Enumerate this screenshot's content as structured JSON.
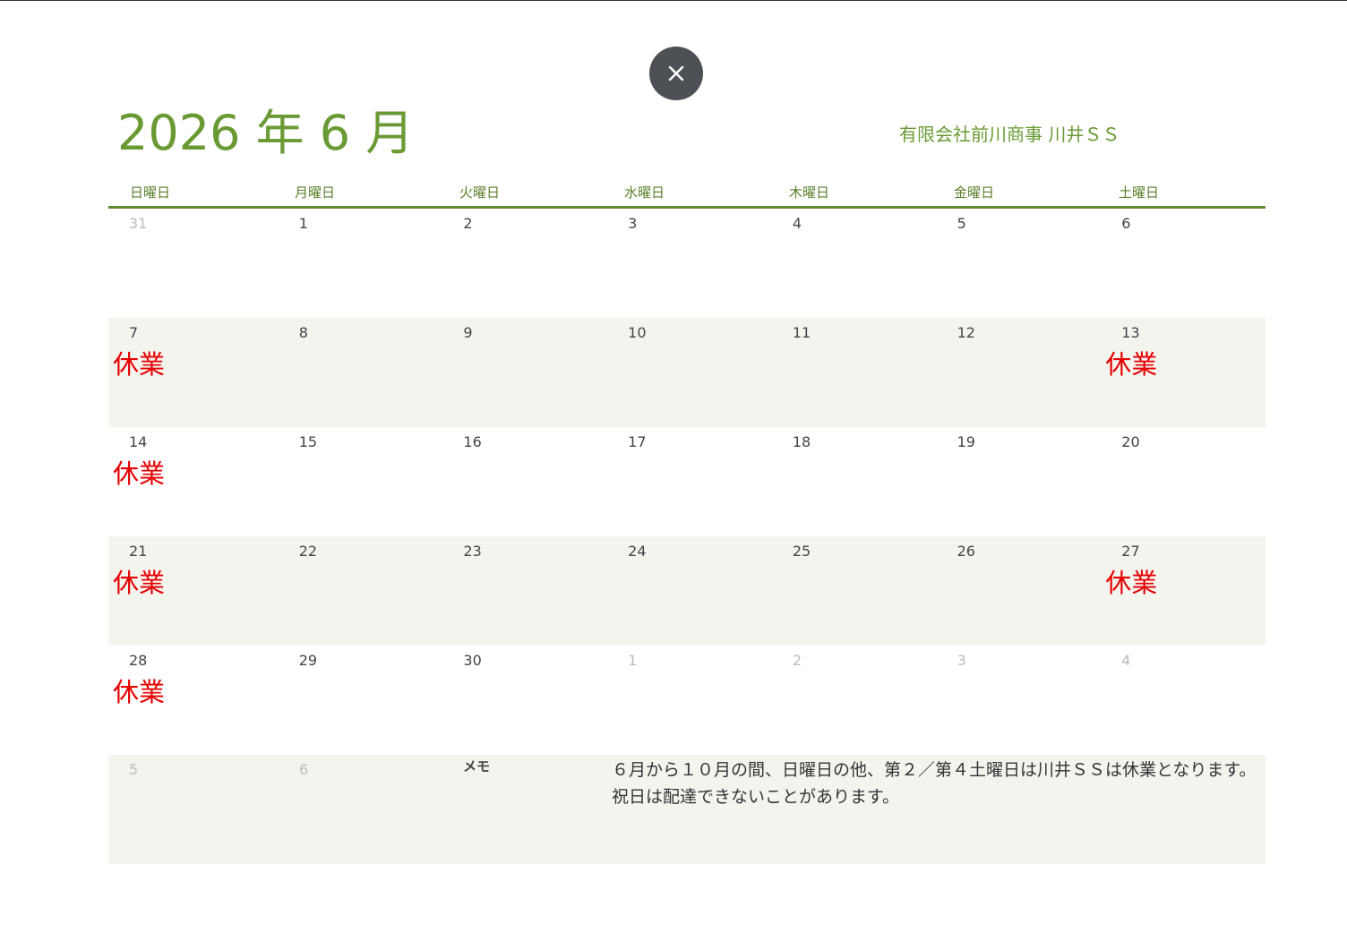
{
  "header": {
    "month_title": "2026 年 6 月",
    "company": "有限会社前川商事  川井ＳＳ"
  },
  "weekdays": [
    "日曜日",
    "月曜日",
    "火曜日",
    "水曜日",
    "木曜日",
    "金曜日",
    "土曜日"
  ],
  "weeks": [
    [
      {
        "day": "31",
        "other": true,
        "note": ""
      },
      {
        "day": "1",
        "other": false,
        "note": ""
      },
      {
        "day": "2",
        "other": false,
        "note": ""
      },
      {
        "day": "3",
        "other": false,
        "note": ""
      },
      {
        "day": "4",
        "other": false,
        "note": ""
      },
      {
        "day": "5",
        "other": false,
        "note": ""
      },
      {
        "day": "6",
        "other": false,
        "note": ""
      }
    ],
    [
      {
        "day": "7",
        "other": false,
        "note": "休業"
      },
      {
        "day": "8",
        "other": false,
        "note": ""
      },
      {
        "day": "9",
        "other": false,
        "note": ""
      },
      {
        "day": "10",
        "other": false,
        "note": ""
      },
      {
        "day": "11",
        "other": false,
        "note": ""
      },
      {
        "day": "12",
        "other": false,
        "note": ""
      },
      {
        "day": "13",
        "other": false,
        "note": "休業"
      }
    ],
    [
      {
        "day": "14",
        "other": false,
        "note": "休業"
      },
      {
        "day": "15",
        "other": false,
        "note": ""
      },
      {
        "day": "16",
        "other": false,
        "note": ""
      },
      {
        "day": "17",
        "other": false,
        "note": ""
      },
      {
        "day": "18",
        "other": false,
        "note": ""
      },
      {
        "day": "19",
        "other": false,
        "note": ""
      },
      {
        "day": "20",
        "other": false,
        "note": ""
      }
    ],
    [
      {
        "day": "21",
        "other": false,
        "note": "休業"
      },
      {
        "day": "22",
        "other": false,
        "note": ""
      },
      {
        "day": "23",
        "other": false,
        "note": ""
      },
      {
        "day": "24",
        "other": false,
        "note": ""
      },
      {
        "day": "25",
        "other": false,
        "note": ""
      },
      {
        "day": "26",
        "other": false,
        "note": ""
      },
      {
        "day": "27",
        "other": false,
        "note": "休業"
      }
    ],
    [
      {
        "day": "28",
        "other": false,
        "note": "休業"
      },
      {
        "day": "29",
        "other": false,
        "note": ""
      },
      {
        "day": "30",
        "other": false,
        "note": ""
      },
      {
        "day": "1",
        "other": true,
        "note": ""
      },
      {
        "day": "2",
        "other": true,
        "note": ""
      },
      {
        "day": "3",
        "other": true,
        "note": ""
      },
      {
        "day": "4",
        "other": true,
        "note": ""
      }
    ]
  ],
  "last_row": {
    "days": [
      "5",
      "6"
    ],
    "memo_label": "メモ",
    "memo_lines": [
      "６月から１０月の間、日曜日の他、第２／第４土曜日は川井ＳＳは休業となります。",
      "祝日は配達できないことがあります。"
    ]
  },
  "icons": {
    "close": "close-icon"
  },
  "colors": {
    "accent": "#6a9a34",
    "header_rule": "#5e8a2e",
    "closed": "#e60000",
    "shaded_row": "#f4f4ef",
    "close_button": "#4d5055"
  }
}
